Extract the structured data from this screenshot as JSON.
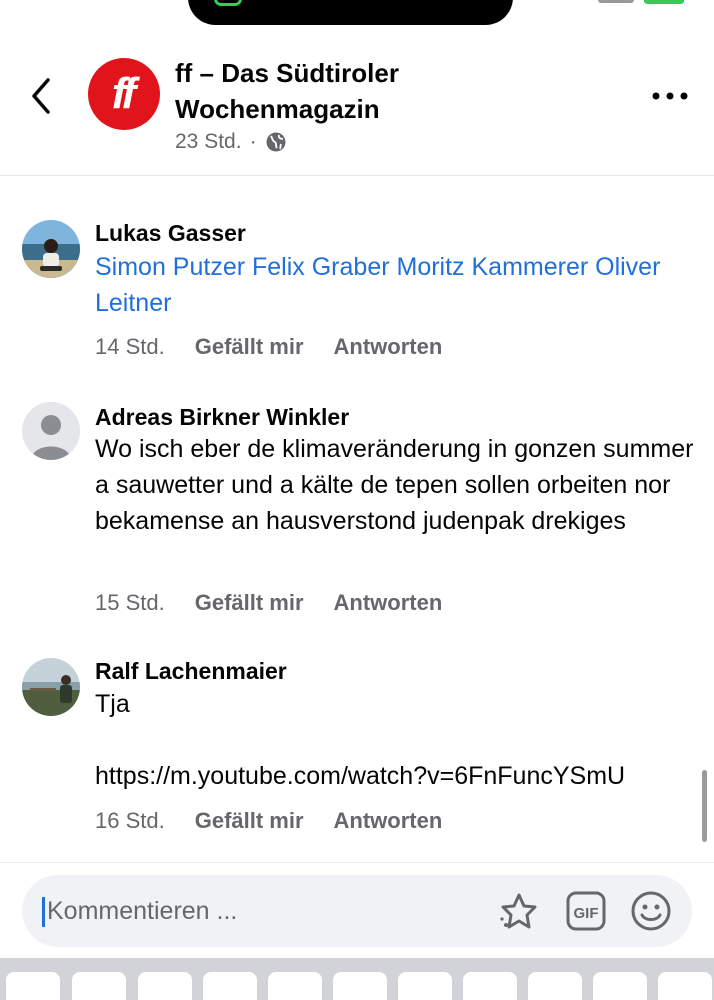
{
  "header": {
    "page_name": "ff – Das Südtiroler Wochenmagazin",
    "logo_text": "ff",
    "time": "23 Std.",
    "separator": "·"
  },
  "comments": [
    {
      "author": "Lukas Gasser",
      "mentions": "Simon Putzer Felix Graber Moritz Kammerer Oliver Leitner",
      "time": "14 Std.",
      "like": "Gefällt mir",
      "reply": "Antworten"
    },
    {
      "author": "Adreas Birkner Winkler",
      "text": "Wo isch eber de klimaveränderung in gonzen summer a sauwetter und a kälte de tepen sollen orbeiten nor bekamense an hausverstond judenpak drekiges",
      "time": "15 Std.",
      "like": "Gefällt mir",
      "reply": "Antworten"
    },
    {
      "author": "Ralf Lachenmaier",
      "text": "Tja",
      "link": "https://m.youtube.com/watch?v=6FnFuncYSmU",
      "time": "16 Std.",
      "like": "Gefällt mir",
      "reply": "Antworten"
    }
  ],
  "composer": {
    "placeholder": "Kommentieren ...",
    "gif_label": "GIF"
  },
  "colors": {
    "link": "#216fdb",
    "brand_red": "#e2141b",
    "secondary_text": "#65676b"
  },
  "icons": [
    "back-chevron-icon",
    "globe-icon",
    "more-icon",
    "sticker-icon",
    "gif-icon",
    "emoji-icon"
  ]
}
